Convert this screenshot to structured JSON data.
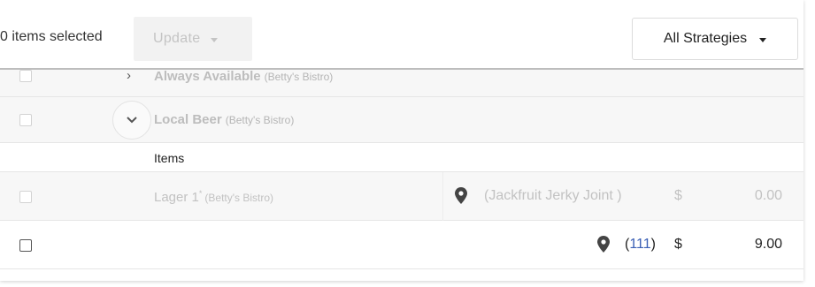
{
  "toolbar": {
    "selected_label": "0 items selected",
    "update_label": "Update",
    "strategy_label": "All Strategies"
  },
  "groups": [
    {
      "title": "Always Available",
      "restaurant": "(Betty's Bistro)"
    },
    {
      "title": "Local Beer",
      "restaurant": "(Betty's Bistro)"
    }
  ],
  "items_header": "Items",
  "rows": [
    {
      "name": "Lager 1",
      "marker": "*",
      "restaurant": "(Betty's Bistro)",
      "location": "(Jackfruit Jerky Joint )",
      "currency": "$",
      "price": "0.00"
    },
    {
      "name": "",
      "location_open": "(",
      "location_link": "111",
      "location_close": ")",
      "currency": "$",
      "price": "9.00"
    }
  ],
  "icons": {
    "caret": "caret-down-icon",
    "pin": "map-pin-icon",
    "chevron_right": "chevron-right-icon",
    "chevron_down": "chevron-down-icon"
  },
  "colors": {
    "faded_text": "#c2c2c2",
    "link": "#3a5fb5",
    "toolbar_divider": "#bdbdbd"
  }
}
